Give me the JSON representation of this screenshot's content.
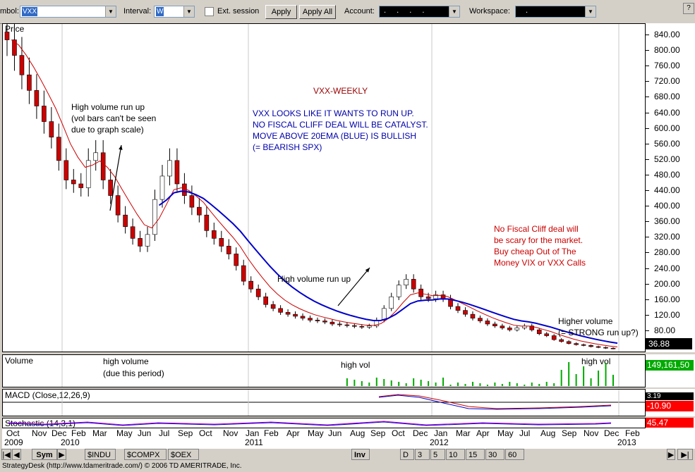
{
  "toolbar": {
    "symbol_label": "mbol:",
    "symbol_value": "VXX",
    "interval_label": "Interval:",
    "interval_value": "W",
    "ext_session_label": "Ext. session",
    "apply_label": "Apply",
    "apply_all_label": "Apply All",
    "account_label": "Account:",
    "account_value": ". . . .",
    "workspace_label": "Workspace:",
    "workspace_value": "."
  },
  "price_pane": {
    "label": "Price",
    "last_price": "36.88",
    "y_ticks": [
      "840.00",
      "800.00",
      "760.00",
      "720.00",
      "680.00",
      "640.00",
      "600.00",
      "560.00",
      "520.00",
      "480.00",
      "440.00",
      "400.00",
      "360.00",
      "320.00",
      "280.00",
      "240.00",
      "200.00",
      "160.00",
      "120.00",
      "80.00"
    ],
    "annotations": {
      "title": "VXX-WEEKLY",
      "blue_1": "VXX LOOKS LIKE IT WANTS TO RUN UP.",
      "blue_2": "NO FISCAL CLIFF DEAL WILL BE CATALYST.",
      "blue_3": "MOVE ABOVE 20EMA (BLUE) IS BULLISH",
      "blue_4": "(= BEARISH SPX)",
      "hv1_1": "High volume run up",
      "hv1_2": "(vol bars can't be seen",
      "hv1_3": "due to graph scale)",
      "hv2": "High volume run up",
      "red_1": "No Fiscal Cliff deal will",
      "red_2": "be scary for the market.",
      "red_3": "Buy cheap Out of The",
      "red_4": "Money VIX or VXX Calls",
      "hv3_1": "Higher volume",
      "hv3_2": "(= STRONG run up?)"
    }
  },
  "volume_pane": {
    "label": "Volume",
    "last_value": "149,161,50",
    "note_1": "high volume",
    "note_2": "(due this period)",
    "note_3": "high vol",
    "note_4": "high vol"
  },
  "macd_pane": {
    "label": "MACD (Close,12,26,9)",
    "value_1": "-10.90",
    "value_2": "3.19"
  },
  "stoch_pane": {
    "label": "Stochastic (14,3,1)",
    "value": "45.47"
  },
  "x_axis": {
    "months": [
      "Oct",
      "Nov",
      "Dec",
      "Feb",
      "Mar",
      "May",
      "Jun",
      "Jul",
      "Sep",
      "Oct",
      "Nov",
      "Jan",
      "Feb",
      "Apr",
      "May",
      "Jun",
      "Aug",
      "Sep",
      "Oct",
      "Dec",
      "Jan",
      "Mar",
      "Apr",
      "May",
      "Jul",
      "Aug",
      "Sep",
      "Nov",
      "Dec",
      "Feb"
    ],
    "years": [
      "2009",
      "2010",
      "2011",
      "2012",
      "2013"
    ]
  },
  "bottom_tabs": {
    "sym": "Sym",
    "indu": "$INDU",
    "compx": "$COMPX",
    "oex": "$OEX",
    "inv": "Inv",
    "periods": [
      "D",
      "3",
      "5",
      "10",
      "15",
      "30",
      "60"
    ]
  },
  "status": "StrategyDesk (http://www.tdameritrade.com/) © 2006 TD AMERITRADE, Inc.",
  "colors": {
    "bull_candle": "#ffffff",
    "bear_candle": "#cc0000",
    "ema_fast": "#cc0000",
    "ema_slow": "#0000cc",
    "volume_bar": "#00aa00",
    "annotation_blue": "#0000aa",
    "annotation_red": "#cc0000"
  },
  "chart_data": {
    "type": "candlestick",
    "title": "VXX-WEEKLY",
    "ylabel": "Price",
    "ylim": [
      40,
      860
    ],
    "series": [
      {
        "name": "",
        "type": "candle",
        "approx_close_path": [
          830,
          790,
          740,
          700,
          660,
          620,
          580,
          520,
          470,
          460,
          450,
          520,
          540,
          470,
          430,
          380,
          350,
          320,
          300,
          330,
          420,
          480,
          520,
          460,
          430,
          400,
          380,
          340,
          320,
          300,
          280,
          250,
          210,
          190,
          170,
          150,
          140,
          130,
          125,
          120,
          115,
          110,
          108,
          105,
          100,
          98,
          96,
          94,
          92,
          95,
          110,
          140,
          170,
          200,
          215,
          190,
          170,
          165,
          175,
          165,
          145,
          135,
          125,
          115,
          108,
          100,
          95,
          90,
          85,
          90,
          95,
          85,
          75,
          70,
          60,
          55,
          50,
          47,
          45,
          42,
          40,
          38,
          37
        ]
      },
      {
        "name": "",
        "type": "line",
        "label": "20 EMA",
        "color": "#0000cc"
      },
      {
        "name": "",
        "type": "line",
        "color": "#cc0000"
      }
    ]
  }
}
